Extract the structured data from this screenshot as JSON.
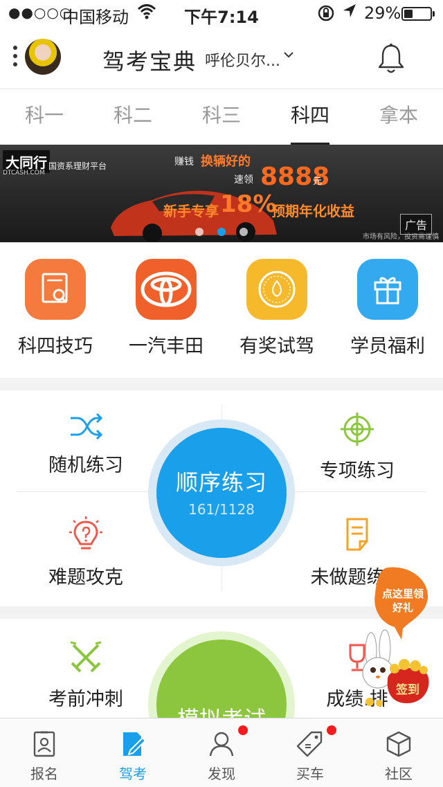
{
  "status_bar": {
    "signal": "●●○○○",
    "carrier": "中国移动",
    "time": "下午7:14",
    "battery": "29%"
  },
  "header": {
    "title": "驾考宝典",
    "city": "呼伦贝尔..."
  },
  "tabs": [
    {
      "label": "科一",
      "active": false
    },
    {
      "label": "科二",
      "active": false
    },
    {
      "label": "科三",
      "active": false
    },
    {
      "label": "科四",
      "active": true
    },
    {
      "label": "拿本",
      "active": false
    }
  ],
  "banner": {
    "brand": "大同行",
    "brand_sub": "DTCASH.COM",
    "platform": "国资系理财平台",
    "line1_prefix": "赚钱",
    "line1_highlight": "换辆好的",
    "line2_prefix": "速领",
    "amount": "8888",
    "unit": "元",
    "promo_left": "新手专享",
    "rate": "18%",
    "promo_right": "预期年化收益",
    "risk": "市场有风险，投资需谨慎",
    "ad_label": "广告",
    "slide_count": 3,
    "active_slide": 2
  },
  "quick_links": [
    {
      "label": "科四技巧",
      "icon": "certificate-icon",
      "color": "#f57a3d"
    },
    {
      "label": "一汽丰田",
      "icon": "toyota-logo-icon",
      "color": "#f0602a"
    },
    {
      "label": "有奖试驾",
      "icon": "medal-icon",
      "color": "#f6b92b"
    },
    {
      "label": "学员福利",
      "icon": "gift-icon",
      "color": "#33a9ef"
    }
  ],
  "practice": {
    "random": "随机练习",
    "special": "专项练习",
    "difficult": "难题攻克",
    "undone": "未做题练习",
    "sequential": {
      "label": "顺序练习",
      "progress": "161/1128",
      "done": 161,
      "total": 1128
    }
  },
  "exam": {
    "sprint": "考前冲刺",
    "score": "成绩.排",
    "mock": "模拟考试"
  },
  "promo": {
    "bubble": "点这里领好礼",
    "sign": "签到"
  },
  "bottom_nav": [
    {
      "label": "报名",
      "icon": "id-card-icon",
      "active": false,
      "badge": false
    },
    {
      "label": "驾考",
      "icon": "document-pen-icon",
      "active": true,
      "badge": false
    },
    {
      "label": "发现",
      "icon": "person-icon",
      "active": false,
      "badge": true
    },
    {
      "label": "买车",
      "icon": "price-tag-icon",
      "active": false,
      "badge": true
    },
    {
      "label": "社区",
      "icon": "cube-box-icon",
      "active": false,
      "badge": false
    }
  ],
  "colors": {
    "accent": "#1a9fea",
    "green": "#8cc63f",
    "badge": "#f41c1c"
  }
}
